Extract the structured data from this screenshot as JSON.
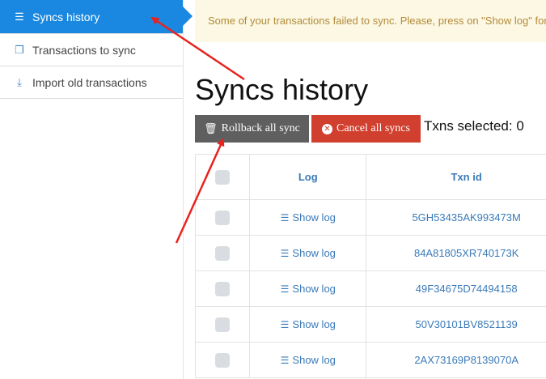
{
  "sidebar": {
    "items": [
      {
        "label": "Syncs history",
        "icon": "list-icon",
        "active": true
      },
      {
        "label": "Transactions to sync",
        "icon": "copy-icon",
        "active": false
      },
      {
        "label": "Import old transactions",
        "icon": "download-icon",
        "active": false
      }
    ]
  },
  "alert": {
    "text": "Some of your transactions failed to sync. Please, press on \"Show log\" for"
  },
  "page": {
    "title": "Syncs history"
  },
  "toolbar": {
    "rollback_label": "Rollback all sync",
    "cancel_label": "Cancel all syncs",
    "selected_text": "Txns selected: 0"
  },
  "table": {
    "columns": [
      "",
      "Log",
      "Txn id"
    ],
    "show_log_label": "Show log",
    "rows": [
      {
        "txn_id": "5GH53435AK993473M"
      },
      {
        "txn_id": "84A81805XR740173K"
      },
      {
        "txn_id": "49F34675D74494158"
      },
      {
        "txn_id": "50V30101BV8521139"
      },
      {
        "txn_id": "2AX73169P8139070A"
      }
    ]
  },
  "colors": {
    "active_nav": "#1a88e0",
    "rollback_button": "#5f5f5f",
    "cancel_button": "#d13f2f",
    "alert_bg": "#fcf8e3",
    "link": "#3a7ab8",
    "annotation_arrow": "#e8231f"
  }
}
